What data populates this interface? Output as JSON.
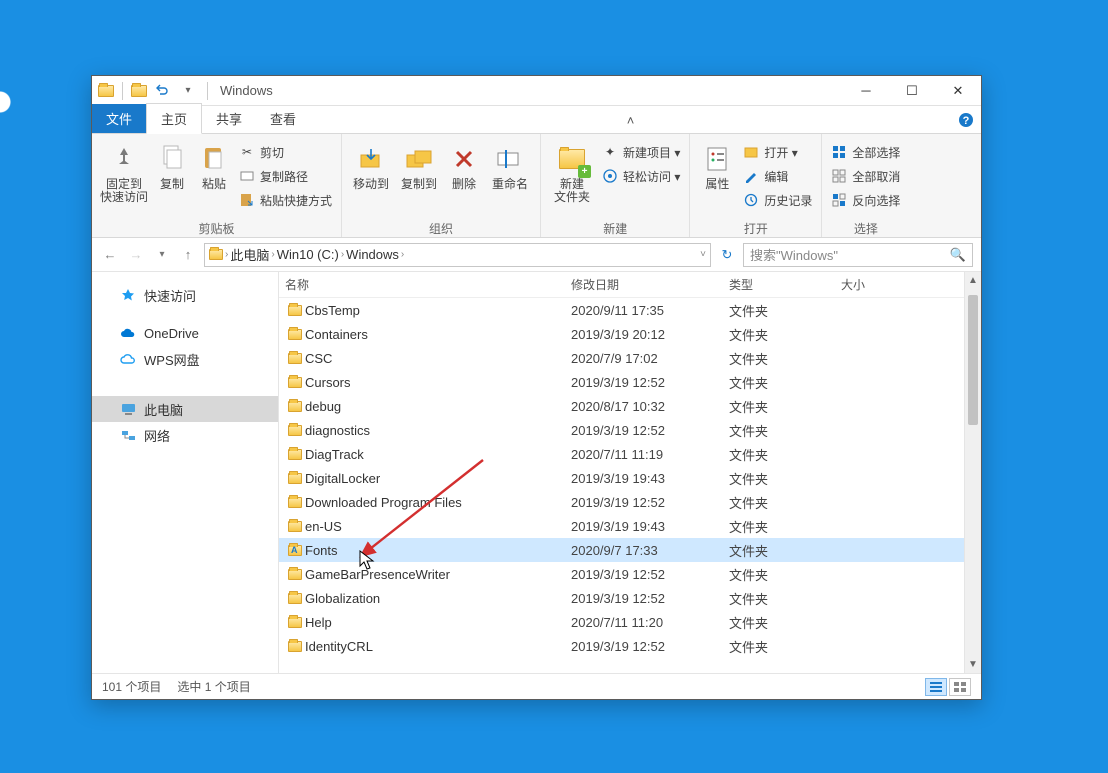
{
  "title": "Windows",
  "tabs": {
    "file": "文件",
    "home": "主页",
    "share": "共享",
    "view": "查看"
  },
  "ribbon": {
    "pinLabel": "固定到\n快速访问",
    "copy": "复制",
    "paste": "粘贴",
    "cut": "剪切",
    "copyPath": "复制路径",
    "pasteShortcut": "粘贴快捷方式",
    "groupClipboard": "剪贴板",
    "moveTo": "移动到",
    "copyTo": "复制到",
    "delete": "删除",
    "rename": "重命名",
    "groupOrganize": "组织",
    "newFolder": "新建\n文件夹",
    "newItem": "新建项目 ▾",
    "easyAccess": "轻松访问 ▾",
    "groupNew": "新建",
    "properties": "属性",
    "open": "打开 ▾",
    "edit": "编辑",
    "history": "历史记录",
    "groupOpen": "打开",
    "selectAll": "全部选择",
    "selectNone": "全部取消",
    "invertSel": "反向选择",
    "groupSelect": "选择"
  },
  "breadcrumb": [
    "此电脑",
    "Win10 (C:)",
    "Windows"
  ],
  "searchPlaceholder": "搜索\"Windows\"",
  "sidebar": [
    {
      "id": "quick",
      "label": "快速访问",
      "icon": "star"
    },
    {
      "id": "onedrive",
      "label": "OneDrive",
      "icon": "cloud-blue"
    },
    {
      "id": "wps",
      "label": "WPS网盘",
      "icon": "cloud-outline"
    },
    {
      "id": "thispc",
      "label": "此电脑",
      "icon": "pc",
      "selected": true
    },
    {
      "id": "network",
      "label": "网络",
      "icon": "net"
    }
  ],
  "columns": {
    "name": "名称",
    "date": "修改日期",
    "type": "类型",
    "size": "大小"
  },
  "rows": [
    {
      "name": "CbsTemp",
      "date": "2020/9/11 17:35",
      "type": "文件夹"
    },
    {
      "name": "Containers",
      "date": "2019/3/19 20:12",
      "type": "文件夹"
    },
    {
      "name": "CSC",
      "date": "2020/7/9 17:02",
      "type": "文件夹"
    },
    {
      "name": "Cursors",
      "date": "2019/3/19 12:52",
      "type": "文件夹"
    },
    {
      "name": "debug",
      "date": "2020/8/17 10:32",
      "type": "文件夹"
    },
    {
      "name": "diagnostics",
      "date": "2019/3/19 12:52",
      "type": "文件夹"
    },
    {
      "name": "DiagTrack",
      "date": "2020/7/11 11:19",
      "type": "文件夹"
    },
    {
      "name": "DigitalLocker",
      "date": "2019/3/19 19:43",
      "type": "文件夹"
    },
    {
      "name": "Downloaded Program Files",
      "date": "2019/3/19 12:52",
      "type": "文件夹"
    },
    {
      "name": "en-US",
      "date": "2019/3/19 19:43",
      "type": "文件夹"
    },
    {
      "name": "Fonts",
      "date": "2020/9/7 17:33",
      "type": "文件夹",
      "selected": true,
      "icon": "fonts"
    },
    {
      "name": "GameBarPresenceWriter",
      "date": "2019/3/19 12:52",
      "type": "文件夹"
    },
    {
      "name": "Globalization",
      "date": "2019/3/19 12:52",
      "type": "文件夹"
    },
    {
      "name": "Help",
      "date": "2020/7/11 11:20",
      "type": "文件夹"
    },
    {
      "name": "IdentityCRL",
      "date": "2019/3/19 12:52",
      "type": "文件夹"
    }
  ],
  "status": {
    "items": "101 个项目",
    "selected": "选中 1 个项目"
  }
}
